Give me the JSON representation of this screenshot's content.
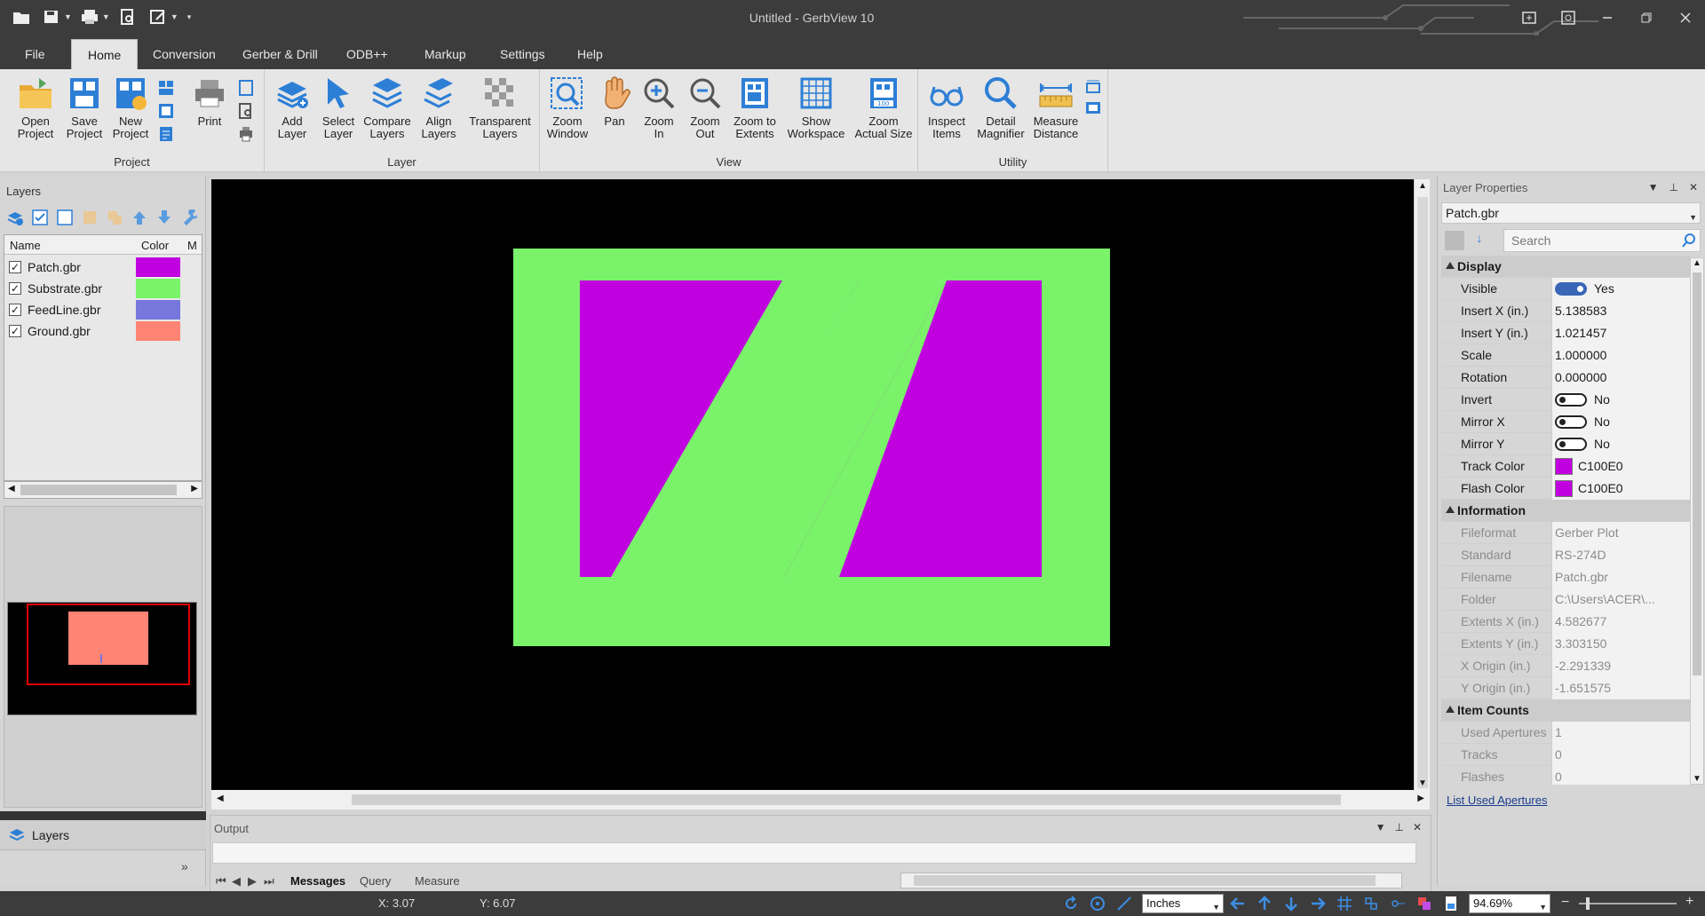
{
  "window": {
    "title": "Untitled - GerbView 10"
  },
  "menu": {
    "tabs": [
      {
        "label": "File"
      },
      {
        "label": "Home"
      },
      {
        "label": "Conversion"
      },
      {
        "label": "Gerber & Drill"
      },
      {
        "label": "ODB++"
      },
      {
        "label": "Markup"
      },
      {
        "label": "Settings"
      },
      {
        "label": "Help"
      }
    ],
    "active_tab": "Home"
  },
  "ribbon": {
    "groups": {
      "project": "Project",
      "layer": "Layer",
      "view": "View",
      "utility": "Utility"
    },
    "buttons": {
      "open_project": "Open\nProject",
      "save_project": "Save\nProject",
      "new_project": "New\nProject",
      "print": "Print",
      "add_layer": "Add\nLayer",
      "select_layer": "Select\nLayer",
      "compare_layers": "Compare\nLayers",
      "align_layers": "Align\nLayers",
      "transparent_layers": "Transparent\nLayers",
      "zoom_window": "Zoom\nWindow",
      "pan": "Pan",
      "zoom_in": "Zoom\nIn",
      "zoom_out": "Zoom\nOut",
      "zoom_to_extents": "Zoom to\nExtents",
      "show_workspace": "Show\nWorkspace",
      "zoom_actual_size": "Zoom\nActual Size",
      "inspect_items": "Inspect\nItems",
      "detail_magnifier": "Detail\nMagnifier",
      "measure_distance": "Measure\nDistance"
    }
  },
  "layers_panel": {
    "title": "Layers",
    "columns": [
      "Name",
      "Color",
      "M"
    ],
    "rows": [
      {
        "name": "Patch.gbr",
        "checked": true,
        "color": "#C100E0"
      },
      {
        "name": "Substrate.gbr",
        "checked": true,
        "color": "#7AF26A"
      },
      {
        "name": "FeedLine.gbr",
        "checked": true,
        "color": "#7777DD"
      },
      {
        "name": "Ground.gbr",
        "checked": true,
        "color": "#FF8474"
      }
    ],
    "tab_label": "Layers"
  },
  "colors": {
    "patch": "#C100E0",
    "substrate": "#7AF26A",
    "feedline": "#7777DD",
    "ground": "#FF8474",
    "canvas_bg": "#000000"
  },
  "output_panel": {
    "title": "Output",
    "tabs": [
      "Messages",
      "Query",
      "Measure"
    ],
    "active_tab": "Messages"
  },
  "properties": {
    "title": "Layer Properties",
    "selected_layer": "Patch.gbr",
    "search_placeholder": "Search",
    "sections": {
      "display": "Display",
      "information": "Information",
      "item_counts": "Item Counts"
    },
    "display": {
      "visible": {
        "key": "Visible",
        "value": "Yes"
      },
      "insert_x": {
        "key": "Insert X (in.)",
        "value": "5.138583"
      },
      "insert_y": {
        "key": "Insert Y (in.)",
        "value": "1.021457"
      },
      "scale": {
        "key": "Scale",
        "value": "1.000000"
      },
      "rotation": {
        "key": "Rotation",
        "value": "0.000000"
      },
      "invert": {
        "key": "Invert",
        "value": "No"
      },
      "mirror_x": {
        "key": "Mirror X",
        "value": "No"
      },
      "mirror_y": {
        "key": "Mirror Y",
        "value": "No"
      },
      "track_color": {
        "key": "Track Color",
        "value": "C100E0"
      },
      "flash_color": {
        "key": "Flash Color",
        "value": "C100E0"
      }
    },
    "information": {
      "fileformat": {
        "key": "Fileformat",
        "value": "Gerber Plot"
      },
      "standard": {
        "key": "Standard",
        "value": "RS-274D"
      },
      "filename": {
        "key": "Filename",
        "value": "Patch.gbr"
      },
      "folder": {
        "key": "Folder",
        "value": "C:\\Users\\ACER\\..."
      },
      "extents_x": {
        "key": "Extents X (in.)",
        "value": "4.582677"
      },
      "extents_y": {
        "key": "Extents Y (in.)",
        "value": "3.303150"
      },
      "x_origin": {
        "key": "X Origin (in.)",
        "value": "-2.291339"
      },
      "y_origin": {
        "key": "Y Origin (in.)",
        "value": "-1.651575"
      }
    },
    "item_counts": {
      "used_apertures": {
        "key": "Used Apertures",
        "value": "1"
      },
      "tracks": {
        "key": "Tracks",
        "value": "0"
      },
      "flashes": {
        "key": "Flashes",
        "value": "0"
      }
    },
    "link": "List Used Apertures"
  },
  "status_bar": {
    "x": "X: 3.07",
    "y": "Y: 6.07",
    "units": "Inches",
    "zoom": "94.69%"
  }
}
